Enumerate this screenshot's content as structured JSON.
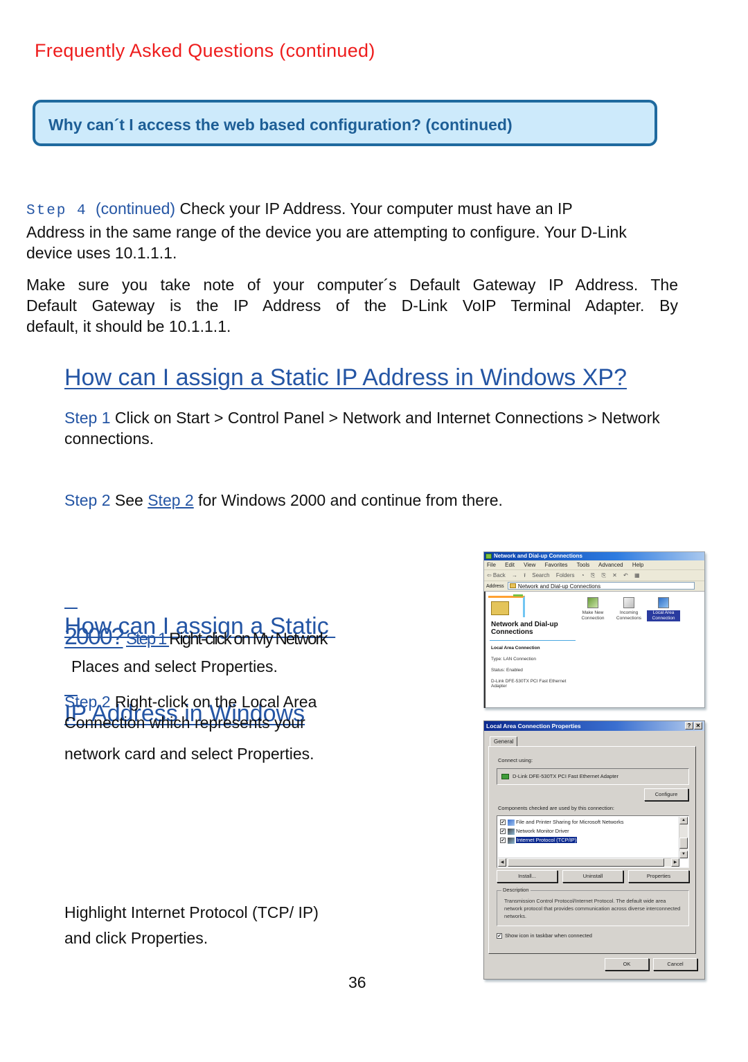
{
  "header": {
    "section_title": "Frequently Asked Questions (continued)",
    "question_box": "Why can´t I access the web based configuration? (continued)"
  },
  "step4": {
    "label": "Step 4",
    "continued": "(continued)",
    "line1": " Check your IP Address. Your computer must have an IP",
    "line2": "Address in the same range of the device you are attempting to configure. Your D-Link",
    "line3": "device uses 10.1.1.1."
  },
  "gateway_paragraph": {
    "line1": "Make sure you take note of your computer´s Default Gateway IP Address. The",
    "line2": "Default Gateway is the IP Address of the D-Link VoIP Terminal Adapter. By",
    "line3": "default, it should be 10.1.1.1."
  },
  "xp_section": {
    "heading": "How can I assign a Static IP Address in Windows XP?",
    "step1_label": "Step 1",
    "step1_text": " Click on Start > Control Panel > Network and Internet Connections > Network",
    "step1_text2": "connections.",
    "step2_label": "Step 2",
    "step2_text_a": " See ",
    "step2_link": "Step 2",
    "step2_text_b": " for Windows 2000 and continue from there."
  },
  "w2000_section": {
    "heading_line1": "How can I assign a Static ",
    "heading_line2": "IP Address in Windows",
    "heading_line3": "2000?",
    "step1_label": "Step 1 ",
    "step1_text": "Right-click on My Network",
    "step1_text2": "Places and select Properties.",
    "step2_label": "Step 2",
    "step2_text": " Right-click on the Local Area",
    "step2_text2": "Connection which represents your",
    "step2_text3": "network card and select Properties.",
    "step3_text": "Highlight Internet Protocol (TCP/ IP)",
    "step3_text2": "and click Properties."
  },
  "page_number": "36",
  "screenshot_network": {
    "title": "Network and Dial-up Connections",
    "menu": [
      "File",
      "Edit",
      "View",
      "Favorites",
      "Tools",
      "Advanced",
      "Help"
    ],
    "toolbar": [
      "⇦ Back",
      "→",
      "⭱",
      "Search",
      "Folders",
      "◔",
      "⎘",
      "⎘",
      "✕",
      "↶",
      "▦"
    ],
    "address_label": "Address",
    "address_value": "Network and Dial-up Connections",
    "banner_title_1": "Network and Dial-up",
    "banner_title_2": "Connections",
    "details": {
      "name": "Local Area Connection",
      "type": "Type: LAN Connection",
      "status": "Status: Enabled",
      "adapter_1": "D-Link DFE-530TX PCI Fast Ethernet",
      "adapter_2": "Adapter"
    },
    "icons": [
      {
        "label1": "Make New",
        "label2": "Connection",
        "selected": false
      },
      {
        "label1": "Incoming",
        "label2": "Connections",
        "selected": false
      },
      {
        "label1": "Local Area",
        "label2": "Connection",
        "selected": true
      }
    ]
  },
  "screenshot_properties": {
    "title": "Local Area Connection Properties",
    "help_btn": "?",
    "close_btn": "✕",
    "tab": "General",
    "connect_using_label": "Connect using:",
    "adapter": "D-Link DFE-530TX PCI Fast Ethernet Adapter",
    "configure_btn": "Configure",
    "components_label": "Components checked are used by this connection:",
    "components": [
      {
        "label": "File and Printer Sharing for Microsoft Networks",
        "checked": true,
        "selected": false
      },
      {
        "label": "Network Monitor Driver",
        "checked": true,
        "selected": false
      },
      {
        "label": "Internet Protocol (TCP/IP)",
        "checked": true,
        "selected": true
      }
    ],
    "install_btn": "Install...",
    "uninstall_btn": "Uninstall",
    "properties_btn": "Properties",
    "description_legend": "Description",
    "description_text": "Transmission Control Protocol/Internet Protocol. The default wide area network protocol that provides communication across diverse interconnected networks.",
    "show_icon_label": "Show icon in taskbar when connected",
    "show_icon_checked": true,
    "ok_btn": "OK",
    "cancel_btn": "Cancel"
  },
  "colors": {
    "section_title_red": "#ee1c1c",
    "link_blue": "#2455a4",
    "box_fill": "#cdeafb",
    "box_border": "#1f6a9f"
  }
}
